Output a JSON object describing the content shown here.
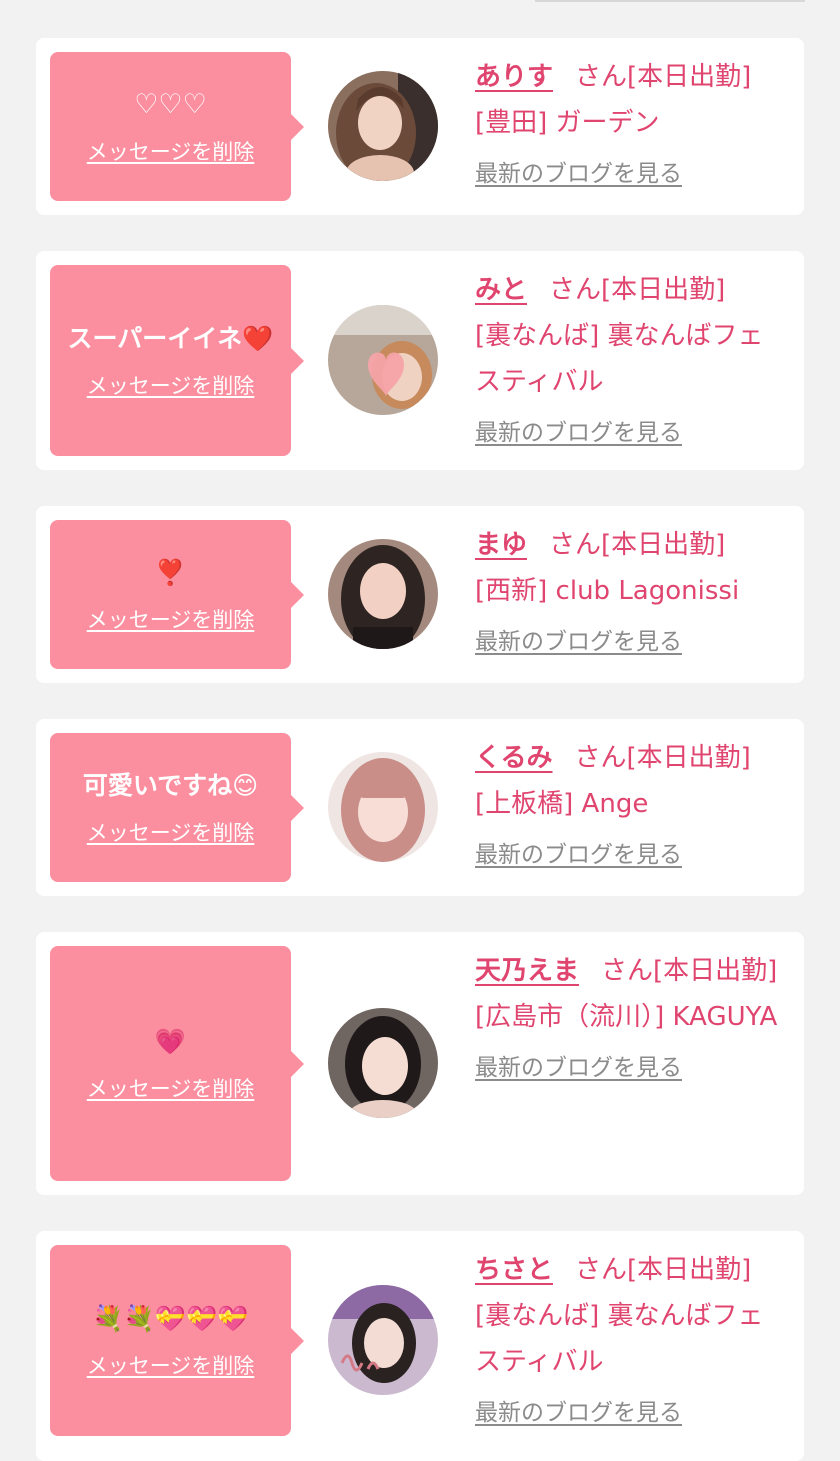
{
  "labels": {
    "delete_message": "メッセージを削除",
    "latest_blog": "最新のブログを見る",
    "san": "さん"
  },
  "colors": {
    "page_background": "#f2f2f2",
    "card_background": "#ffffff",
    "bubble": "#fb8f9f",
    "accent_text": "#e0456f",
    "link_gray": "#8b8b8b"
  },
  "entries": [
    {
      "message": "♡♡♡",
      "name": "ありす",
      "status": "さん[本日出勤]",
      "shop": "[豊田] ガーデン",
      "avatar": "woman-portrait-1"
    },
    {
      "message": "スーパーイイネ❤️",
      "name": "みと",
      "status": "さん[本日出勤]",
      "shop": "[裏なんば] 裏なんばフェスティバル",
      "avatar": "woman-portrait-heart-sticker"
    },
    {
      "message": "❣️",
      "name": "まゆ",
      "status": "さん[本日出勤]",
      "shop": "[西新] club Lagonissi",
      "avatar": "woman-portrait-3"
    },
    {
      "message": "可愛いですね😊",
      "name": "くるみ",
      "status": "さん[本日出勤]",
      "shop": "[上板橋] Ange",
      "avatar": "woman-portrait-4"
    },
    {
      "message": "💗",
      "name": "天乃えま",
      "status": "さん[本日出勤]",
      "shop": "[広島市（流川）] KAGUYA",
      "avatar": "woman-portrait-5"
    },
    {
      "message": "💐💐💝💝💝",
      "name": "ちさと",
      "status": "さん[本日出勤]",
      "shop": "[裏なんば] 裏なんばフェスティバル",
      "avatar": "woman-portrait-handwritten-name"
    }
  ]
}
